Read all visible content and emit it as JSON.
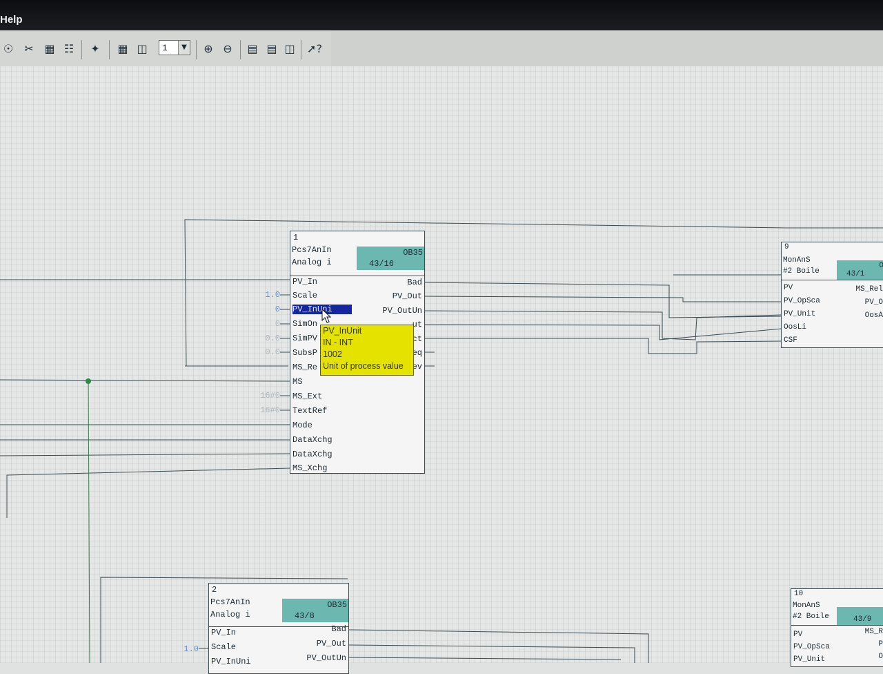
{
  "menu": {
    "help": "Help"
  },
  "toolbar": {
    "icons": [
      "binoculars-icon",
      "scissors-icon",
      "counter-icon",
      "options-icon",
      "fit-icon",
      "table-icon",
      "columns-icon",
      "zoom-in-icon",
      "zoom-out-icon",
      "layers-icon",
      "rows-icon",
      "panel-icon",
      "help-pointer-icon"
    ],
    "page_select_value": "1"
  },
  "block1": {
    "number": "1",
    "type": "Pcs7AnIn",
    "name": "Analog i",
    "ob": "OB35",
    "sequence": "43/16",
    "inputs": [
      "PV_In",
      "Scale",
      "PV_InUni",
      "SimOn",
      "SimPV",
      "SubsP",
      "MS_Re",
      "MS",
      "MS_Ext",
      "TextRef",
      "Mode",
      "DataXchg",
      "DataXchg",
      "MS_Xchg"
    ],
    "outputs": [
      "Bad",
      "PV_Out",
      "PV_OutUn",
      "ut",
      "ct",
      "eq",
      "ev"
    ],
    "params": {
      "scale": "1.0",
      "pv_inunit": "0",
      "simon": "0",
      "simpv": "0.0",
      "subspv": "0.0",
      "ms_ext": "16#0",
      "textref": "16#0"
    }
  },
  "tooltip": {
    "line1": "PV_InUnit",
    "line2": "IN - INT",
    "line3": "1002",
    "line4": "Unit of process value"
  },
  "block9": {
    "number": "9",
    "type": "MonAnS",
    "name": "#2 Boile",
    "sequence": "43/1",
    "ob": "O",
    "inputs": [
      "PV",
      "PV_OpSca",
      "PV_Unit",
      "OosLi",
      "CSF"
    ],
    "outputs": [
      "MS_Rel",
      "PV_O",
      "OosA"
    ]
  },
  "block2": {
    "number": "2",
    "type": "Pcs7AnIn",
    "name": "Analog i",
    "ob": "OB35",
    "sequence": "43/8",
    "inputs": [
      "PV_In",
      "Scale",
      "PV_InUni"
    ],
    "outputs": [
      "Bad",
      "PV_Out",
      "PV_OutUn"
    ],
    "params": {
      "scale": "1.0"
    }
  },
  "block10": {
    "number": "10",
    "type": "MonAnS",
    "name": "#2 Boile",
    "sequence": "43/9",
    "inputs": [
      "PV",
      "PV_OpSca",
      "PV_Unit"
    ],
    "outputs": [
      "MS_R",
      "P",
      "O"
    ]
  }
}
